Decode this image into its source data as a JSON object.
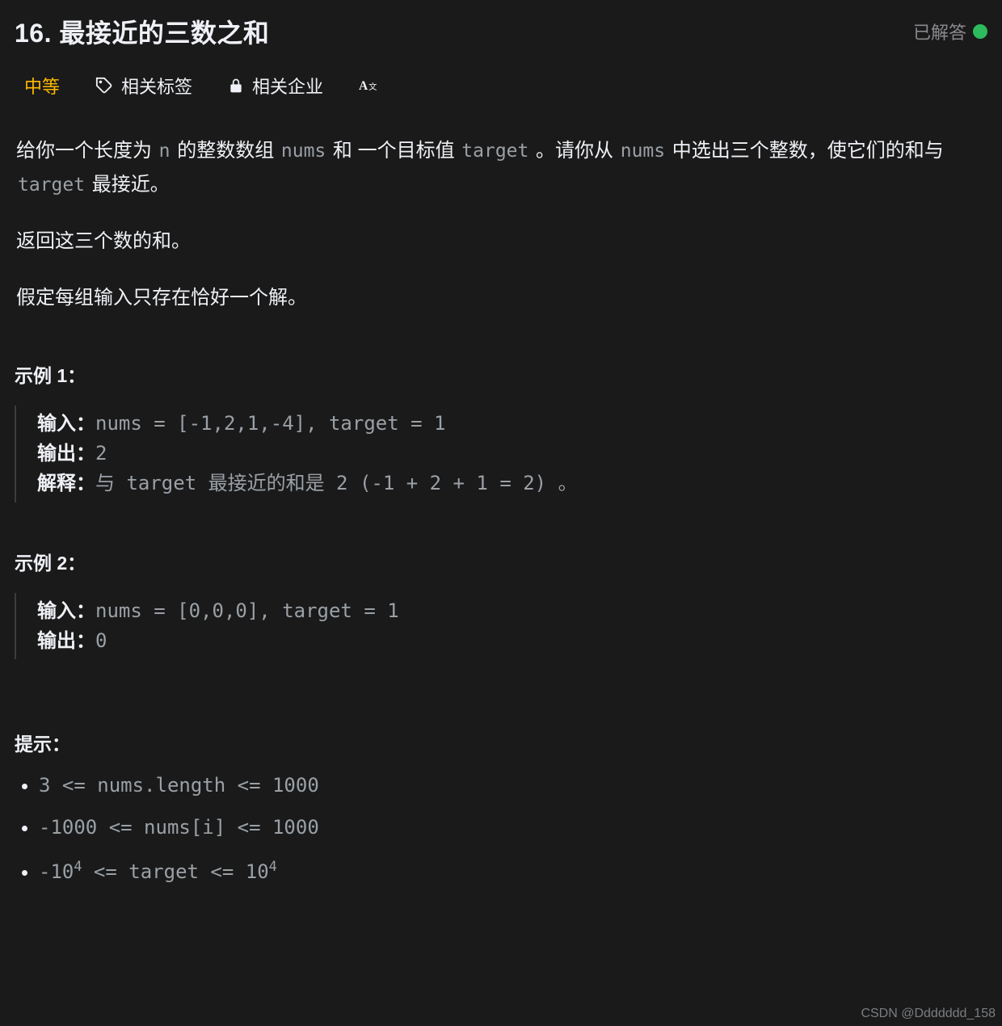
{
  "header": {
    "title": "16. 最接近的三数之和",
    "status_label": "已解答"
  },
  "meta": {
    "difficulty": "中等",
    "tags_label": "相关标签",
    "companies_label": "相关企业"
  },
  "description": {
    "p1_pre": "给你一个长度为 ",
    "p1_code1": "n",
    "p1_mid1": " 的整数数组 ",
    "p1_code2": "nums",
    "p1_mid2": " 和 一个目标值 ",
    "p1_code3": "target",
    "p1_mid3": " 。请你从 ",
    "p1_code4": "nums",
    "p1_mid4": " 中选出三个整数，使它们的和与 ",
    "p1_code5": "target",
    "p1_tail": " 最接近。",
    "p2": "返回这三个数的和。",
    "p3": "假定每组输入只存在恰好一个解。"
  },
  "examples": {
    "ex1_title": "示例 1：",
    "ex1_input_lbl": "输入：",
    "ex1_input_val": "nums = [-1,2,1,-4], target = 1",
    "ex1_output_lbl": "输出：",
    "ex1_output_val": "2",
    "ex1_explain_lbl": "解释：",
    "ex1_explain_val": "与 target 最接近的和是 2 (-1 + 2 + 1 = 2) 。",
    "ex2_title": "示例 2：",
    "ex2_input_lbl": "输入：",
    "ex2_input_val": "nums = [0,0,0], target = 1",
    "ex2_output_lbl": "输出：",
    "ex2_output_val": "0"
  },
  "hints": {
    "title": "提示：",
    "c1": "3 <= nums.length <= 1000",
    "c2": "-1000 <= nums[i] <= 1000",
    "c3_pre": "-10",
    "c3_sup1": "4",
    "c3_mid": " <= target <= 10",
    "c3_sup2": "4"
  },
  "watermark": "CSDN @Ddddddd_158"
}
